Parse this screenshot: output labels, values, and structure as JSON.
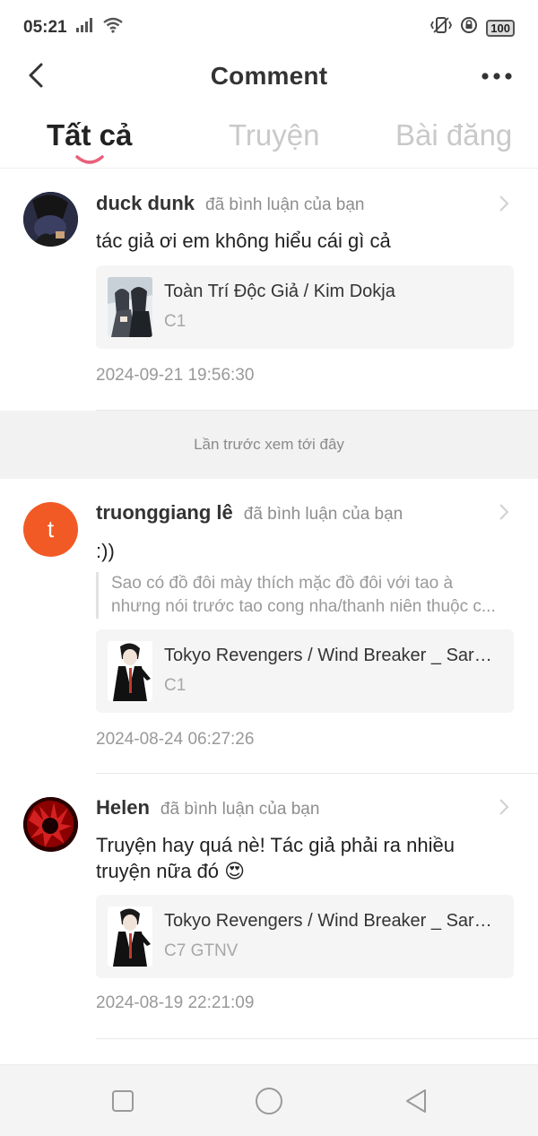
{
  "status_bar": {
    "time": "05:21",
    "battery": "100",
    "icons": [
      "signal-icon",
      "wifi-icon",
      "vibrate-icon",
      "rotation-lock-icon",
      "battery-icon"
    ]
  },
  "header": {
    "title": "Comment",
    "back_icon": "chevron-left-icon",
    "more_icon": "more-horizontal-icon"
  },
  "tabs": [
    {
      "label": "Tất cả",
      "active": true
    },
    {
      "label": "Truyện",
      "active": false
    },
    {
      "label": "Bài đăng",
      "active": false
    }
  ],
  "comments": [
    {
      "user": "duck dunk",
      "action": "đã bình luận của bạn",
      "text": "tác giả ơi em không hiểu cái gì cả",
      "story_title": "Toàn Trí Độc Giả / Kim Dokja",
      "chapter": "C1",
      "time": "2024-09-21 19:56:30"
    },
    {
      "user": "truonggiang lê",
      "avatar_letter": "t",
      "action": "đã bình luận của bạn",
      "text": ":))",
      "quote_line1": "Sao có đồ đôi mày thích mặc đồ đôi với tao à",
      "quote_line2": "nhưng nói trước tao cong nha/thanh niên thuộc c...",
      "story_title": "Tokyo Revengers / Wind Breaker _ Saruk...",
      "chapter": "C1",
      "time": "2024-08-24 06:27:26"
    },
    {
      "user": "Helen",
      "action": "đã bình luận của bạn",
      "text_line1": "Truyện hay quá nè! Tác giả phải ra nhiều",
      "text_line2": "truyện nữa đó 😍",
      "story_title": "Tokyo Revengers / Wind Breaker _ Saruk...",
      "chapter": "C7 GTNV",
      "time": "2024-08-19 22:21:09"
    }
  ],
  "last_seen_label": "Lần trước xem tới đây",
  "colors": {
    "accent": "#e8607a",
    "avatar_orange": "#f15a24"
  }
}
